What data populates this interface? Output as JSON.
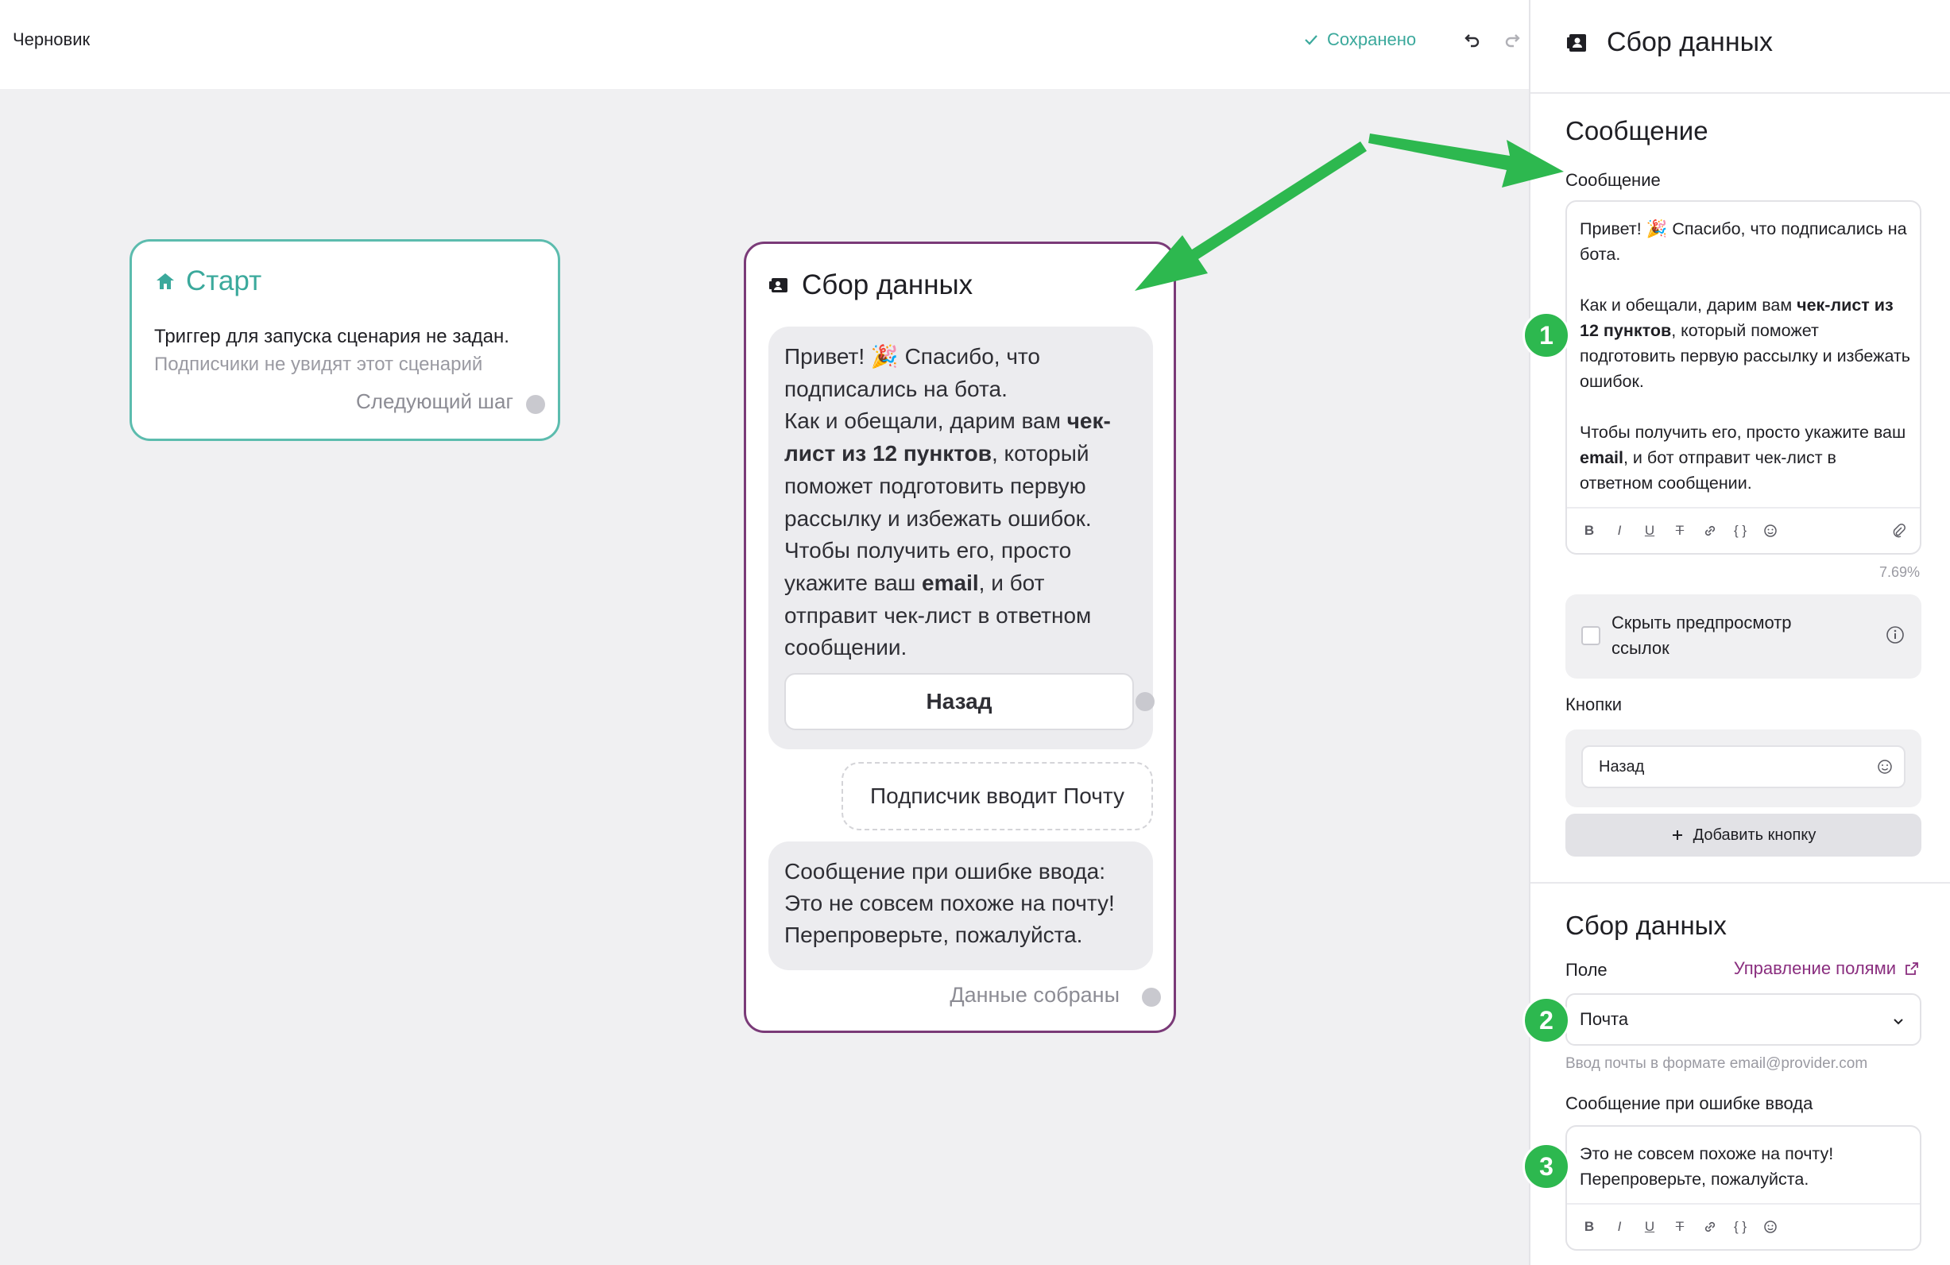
{
  "topbar": {
    "draft_label": "Черновик",
    "saved_label": "Сохранено",
    "undo_icon": "undo-icon",
    "redo_icon": "redo-icon"
  },
  "canvas": {
    "start_node": {
      "title": "Старт",
      "description": "Триггер для запуска сценария не задан.",
      "subtitle": "Подписчики не увидят этот сценарий",
      "next_step": "Следующий шаг"
    },
    "data_node": {
      "title": "Сбор данных",
      "message_parts": [
        "Привет! 🎉 Спасибо, что подписались на бота.",
        "Как и обещали, дарим вам ",
        "чек-лист из 12 пунктов",
        ", который поможет подготовить первую рассылку и избежать ошибок.",
        "Чтобы получить его, просто укажите ваш ",
        "email",
        ", и бот отправит чек-лист в ответном сообщении."
      ],
      "button_label": "Назад",
      "input_label": "Подписчик вводит Почту",
      "error_line1": "Сообщение при ошибке ввода:",
      "error_line2": "Это не совсем похоже на почту! Перепроверьте, пожалуйста.",
      "done_label": "Данные собраны"
    }
  },
  "panel": {
    "header_title": "Сбор данных",
    "message_section": {
      "title": "Сообщение",
      "field_label": "Сообщение",
      "text_parts": [
        "Привет! 🎉 Спасибо, что подписались на бота.",
        "Как и обещали, дарим вам ",
        "чек-лист из 12 пунктов",
        ", который поможет подготовить первую рассылку и избежать ошибок.",
        "Чтобы получить его, просто укажите ваш ",
        "email",
        ", и бот отправит чек-лист в ответном сообщении."
      ],
      "percent": "7.69%",
      "hide_preview_label": "Скрыть предпросмотр ссылок",
      "hide_preview_checked": false,
      "buttons_label": "Кнопки",
      "button_value": "Назад",
      "add_button_label": "Добавить кнопку"
    },
    "data_section": {
      "title": "Сбор данных",
      "field_label": "Поле",
      "manage_link": "Управление полями",
      "selected_field": "Почта",
      "hint": "Ввод почты в формате email@provider.com",
      "error_label": "Сообщение при ошибке ввода",
      "error_text_line1": "Это не совсем похоже на почту!",
      "error_text_line2": "Перепроверьте, пожалуйста."
    },
    "toolbar_glyphs": {
      "bold": "B",
      "italic": "I",
      "underline": "U",
      "strike": "T",
      "code": "{ }"
    }
  },
  "annotations": {
    "markers": [
      "1",
      "2",
      "3"
    ],
    "color": "#2db84f"
  },
  "colors": {
    "start_accent": "#3ba99c",
    "data_node_border": "#7a3a78",
    "link": "#8a2e7f"
  }
}
